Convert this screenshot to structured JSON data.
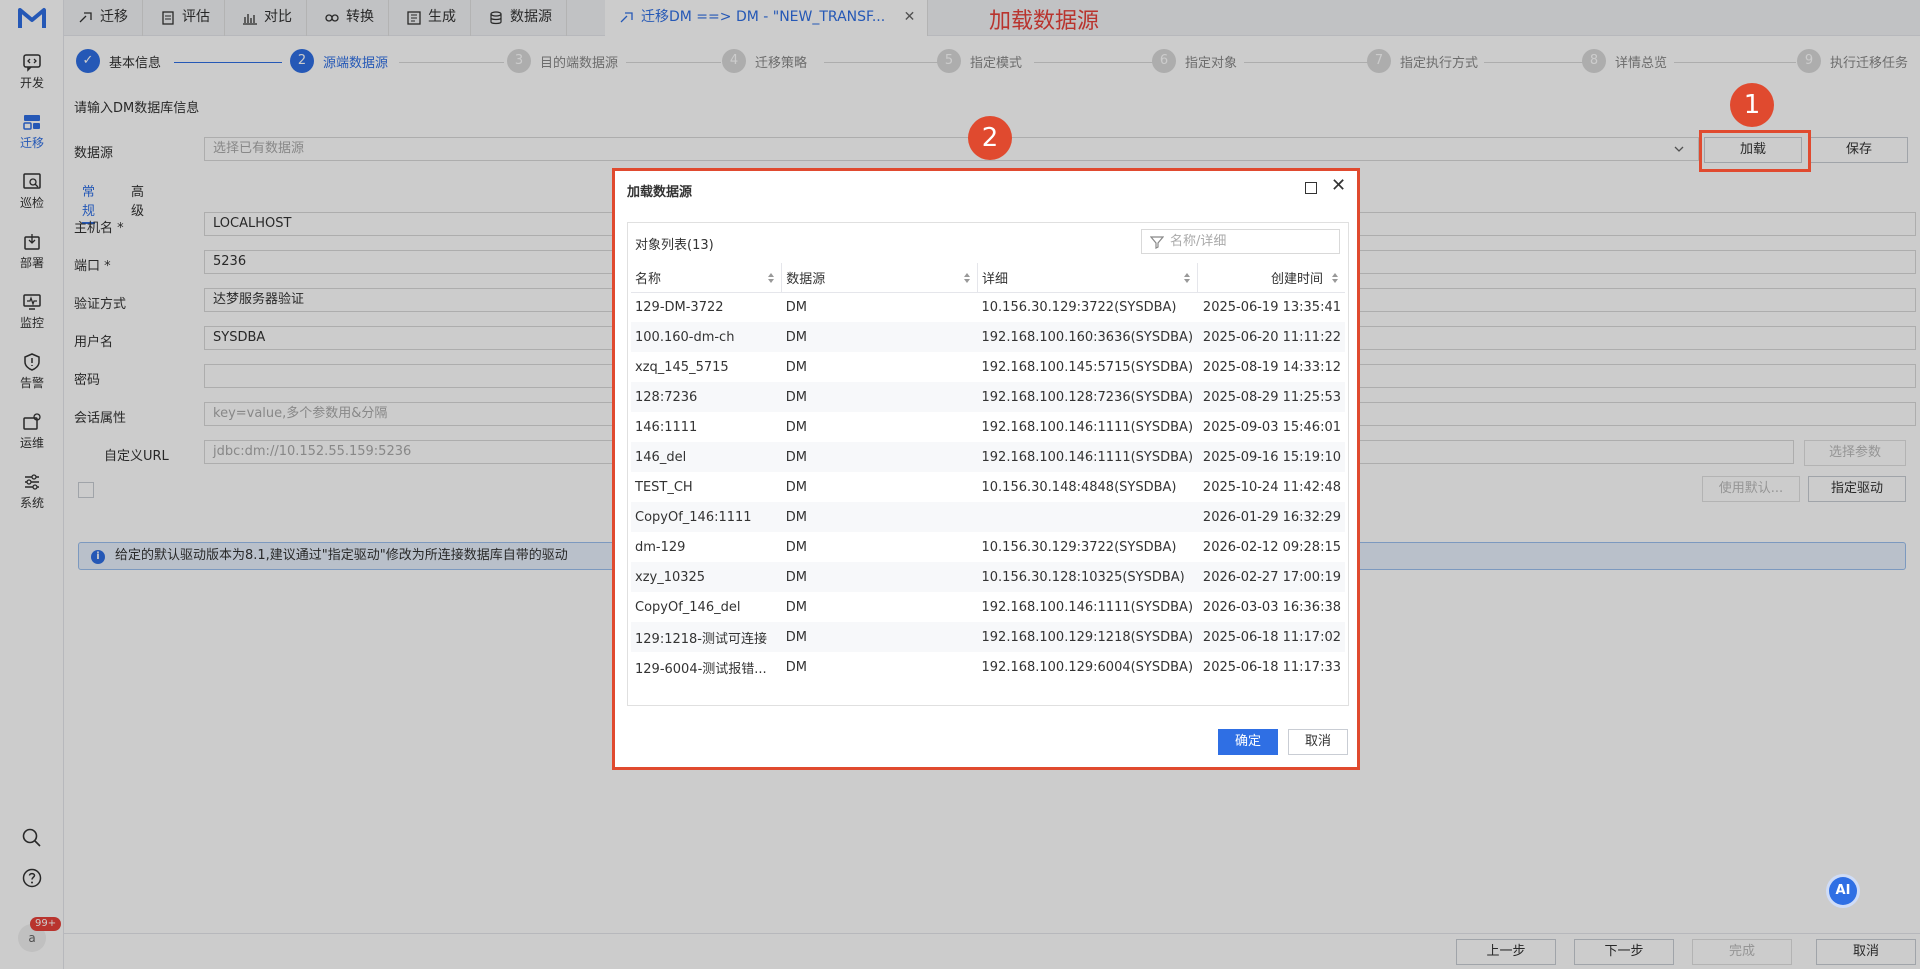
{
  "sidebar": {
    "items": [
      {
        "label": "开发",
        "icon": "code-chat-icon"
      },
      {
        "label": "迁移",
        "icon": "migrate-icon",
        "active": true
      },
      {
        "label": "巡检",
        "icon": "inspect-icon"
      },
      {
        "label": "部署",
        "icon": "deploy-icon"
      },
      {
        "label": "监控",
        "icon": "monitor-icon"
      },
      {
        "label": "告警",
        "icon": "alert-shield-icon"
      },
      {
        "label": "运维",
        "icon": "ops-icon"
      },
      {
        "label": "系统",
        "icon": "settings-sliders-icon"
      }
    ],
    "avatar": "a",
    "badge": "99+"
  },
  "tabs": [
    {
      "label": "迁移"
    },
    {
      "label": "评估"
    },
    {
      "label": "对比"
    },
    {
      "label": "转换"
    },
    {
      "label": "生成"
    },
    {
      "label": "数据源"
    },
    {
      "label": "迁移DM ==> DM - \"NEW_TRANSF..."
    }
  ],
  "annotation": {
    "title": "加载数据源",
    "marker1": "1",
    "marker2": "2"
  },
  "steps": [
    {
      "num": "✓",
      "label": "基本信息"
    },
    {
      "num": "2",
      "label": "源端数据源"
    },
    {
      "num": "3",
      "label": "目的端数据源"
    },
    {
      "num": "4",
      "label": "迁移策略"
    },
    {
      "num": "5",
      "label": "指定模式"
    },
    {
      "num": "6",
      "label": "指定对象"
    },
    {
      "num": "7",
      "label": "指定执行方式"
    },
    {
      "num": "8",
      "label": "详情总览"
    },
    {
      "num": "9",
      "label": "执行迁移任务"
    }
  ],
  "form": {
    "hint": "请输入DM数据库信息",
    "datasource_label": "数据源",
    "datasource_placeholder": "选择已有数据源",
    "load_button": "加载",
    "save_button": "保存",
    "subtab_general": "常规",
    "subtab_advanced": "高级",
    "host_label": "主机名 *",
    "host_value": "LOCALHOST",
    "port_label": "端口 *",
    "port_value": "5236",
    "auth_label": "验证方式",
    "auth_value": "达梦服务器验证",
    "user_label": "用户名",
    "user_value": "SYSDBA",
    "password_label": "密码",
    "session_label": "会话属性",
    "session_placeholder": "key=value,多个参数用&分隔",
    "custom_url_label": "自定义URL",
    "custom_url_placeholder": "jdbc:dm://10.152.55.159:5236",
    "select_params_button": "选择参数",
    "use_default_button": "使用默认...",
    "specify_driver_button": "指定驱动",
    "info_text": "给定的默认驱动版本为8.1,建议通过\"指定驱动\"修改为所连接数据库自带的驱动"
  },
  "footer": {
    "prev": "上一步",
    "next": "下一步",
    "finish": "完成",
    "cancel": "取消"
  },
  "dialog": {
    "title": "加载数据源",
    "list_title": "对象列表(13)",
    "filter_placeholder": "名称/详细",
    "columns": [
      "名称",
      "数据源",
      "详细",
      "创建时间"
    ],
    "rows": [
      [
        "129-DM-3722",
        "DM",
        "10.156.30.129:3722(SYSDBA)",
        "2025-06-19 13:35:41"
      ],
      [
        "100.160-dm-ch",
        "DM",
        "192.168.100.160:3636(SYSDBA)",
        "2025-06-20 11:11:22"
      ],
      [
        "xzq_145_5715",
        "DM",
        "192.168.100.145:5715(SYSDBA)",
        "2025-08-19 14:33:12"
      ],
      [
        "128:7236",
        "DM",
        "192.168.100.128:7236(SYSDBA)",
        "2025-08-29 11:25:53"
      ],
      [
        "146:1111",
        "DM",
        "192.168.100.146:1111(SYSDBA)",
        "2025-09-03 15:46:01"
      ],
      [
        "146_del",
        "DM",
        "192.168.100.146:1111(SYSDBA)",
        "2025-09-16 15:19:10"
      ],
      [
        "TEST_CH",
        "DM",
        "10.156.30.148:4848(SYSDBA)",
        "2025-10-24 11:42:48"
      ],
      [
        "CopyOf_146:1111",
        "DM",
        "",
        "2026-01-29 16:32:29"
      ],
      [
        "dm-129",
        "DM",
        "10.156.30.129:3722(SYSDBA)",
        "2026-02-12 09:28:15"
      ],
      [
        "xzy_10325",
        "DM",
        "10.156.30.128:10325(SYSDBA)",
        "2026-02-27 17:00:19"
      ],
      [
        "CopyOf_146_del",
        "DM",
        "192.168.100.146:1111(SYSDBA)",
        "2026-03-03 16:36:38"
      ],
      [
        "129:1218-测试可连接",
        "DM",
        "192.168.100.129:1218(SYSDBA)",
        "2025-06-18 11:17:02"
      ],
      [
        "129-6004-测试报错...",
        "DM",
        "192.168.100.129:6004(SYSDBA)",
        "2025-06-18 11:17:33"
      ]
    ],
    "ok": "确定",
    "cancel": "取消"
  },
  "ai_label": "AI",
  "colors": {
    "accent": "#2f6fe4",
    "annotation": "#e04a2f"
  }
}
